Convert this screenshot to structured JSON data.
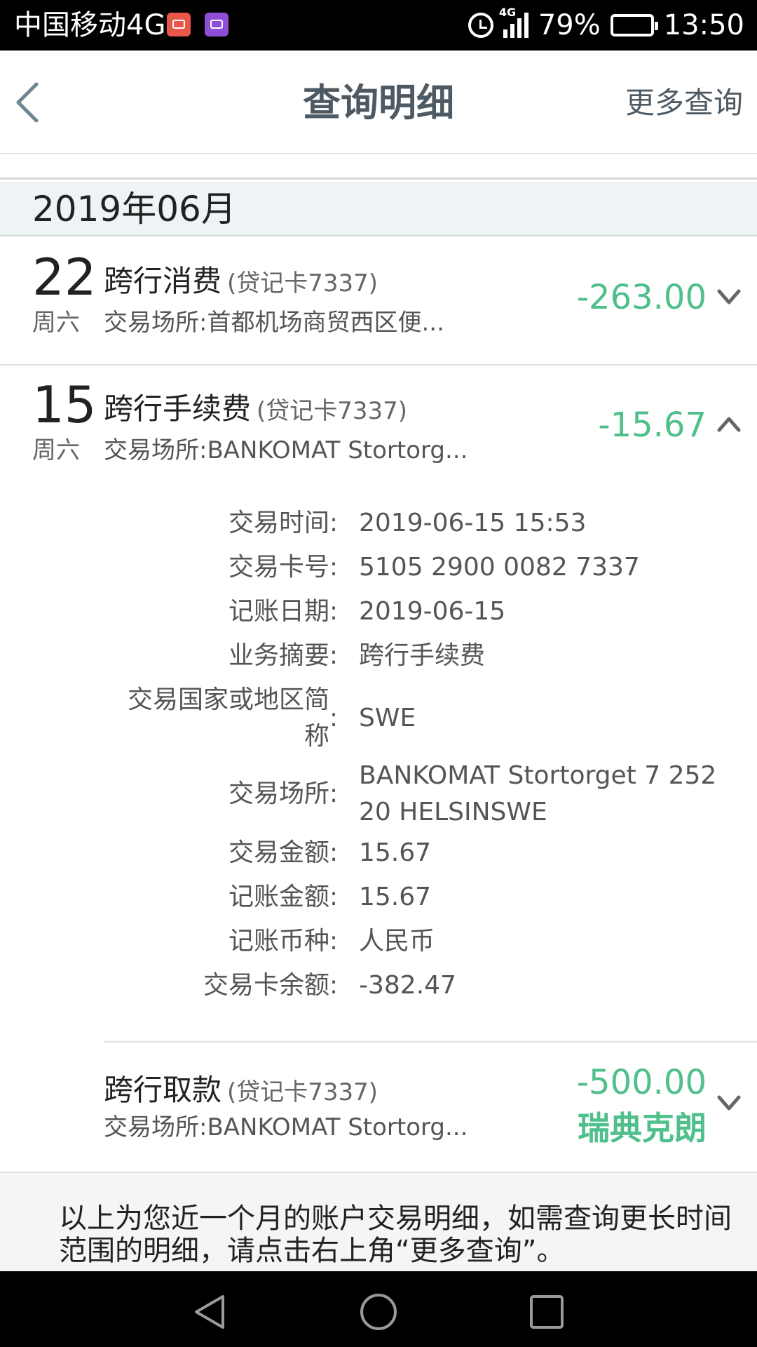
{
  "status_bar": {
    "carrier": "中国移动4G",
    "network": "4G",
    "battery": "79%",
    "battery_level": 0.79,
    "time": "13:50",
    "icons": [
      "mail-app-icon",
      "gallery-app-icon",
      "alarm-icon",
      "signal-icon",
      "battery-icon"
    ]
  },
  "nav": {
    "title": "查询明细",
    "more": "更多查询"
  },
  "month": "2019年06月",
  "transactions": [
    {
      "day": "22",
      "weekday": "周六",
      "name": "跨行消费",
      "card": "(贷记卡7337)",
      "place": "交易场所:首都机场商贸西区便...",
      "amount": "-263.00",
      "expanded": false
    },
    {
      "day": "15",
      "weekday": "周六",
      "name": "跨行手续费",
      "card": "(贷记卡7337)",
      "place": "交易场所:BANKOMAT Stortorg...",
      "amount": "-15.67",
      "expanded": true
    },
    {
      "day": "",
      "weekday": "",
      "name": "跨行取款",
      "card": "(贷记卡7337)",
      "place": "交易场所:BANKOMAT Stortorg...",
      "amount": "-500.00",
      "currency": "瑞典克朗",
      "expanded": false
    }
  ],
  "detail": {
    "colon": ":",
    "rows": [
      {
        "label": "交易时间",
        "value": "2019-06-15 15:53"
      },
      {
        "label": "交易卡号",
        "value": "5105 2900 0082 7337"
      },
      {
        "label": "记账日期",
        "value": "2019-06-15"
      },
      {
        "label": "业务摘要",
        "value": "跨行手续费"
      },
      {
        "label": "交易国家或地区简称",
        "value": "SWE"
      },
      {
        "label": "交易场所",
        "value": "BANKOMAT Stortorget 7 25220 HELSINSWE"
      },
      {
        "label": "交易金额",
        "value": "15.67"
      },
      {
        "label": "记账金额",
        "value": "15.67"
      },
      {
        "label": "记账币种",
        "value": "人民币"
      },
      {
        "label": "交易卡余额",
        "value": "-382.47"
      }
    ]
  },
  "footer_note": "以上为您近一个月的账户交易明细，如需查询更长时间范围的明细，请点击右上角“更多查询”。",
  "colors": {
    "amount": "#4fbf8b",
    "title": "#4e5a63",
    "month_bg": "#eef3f5"
  }
}
